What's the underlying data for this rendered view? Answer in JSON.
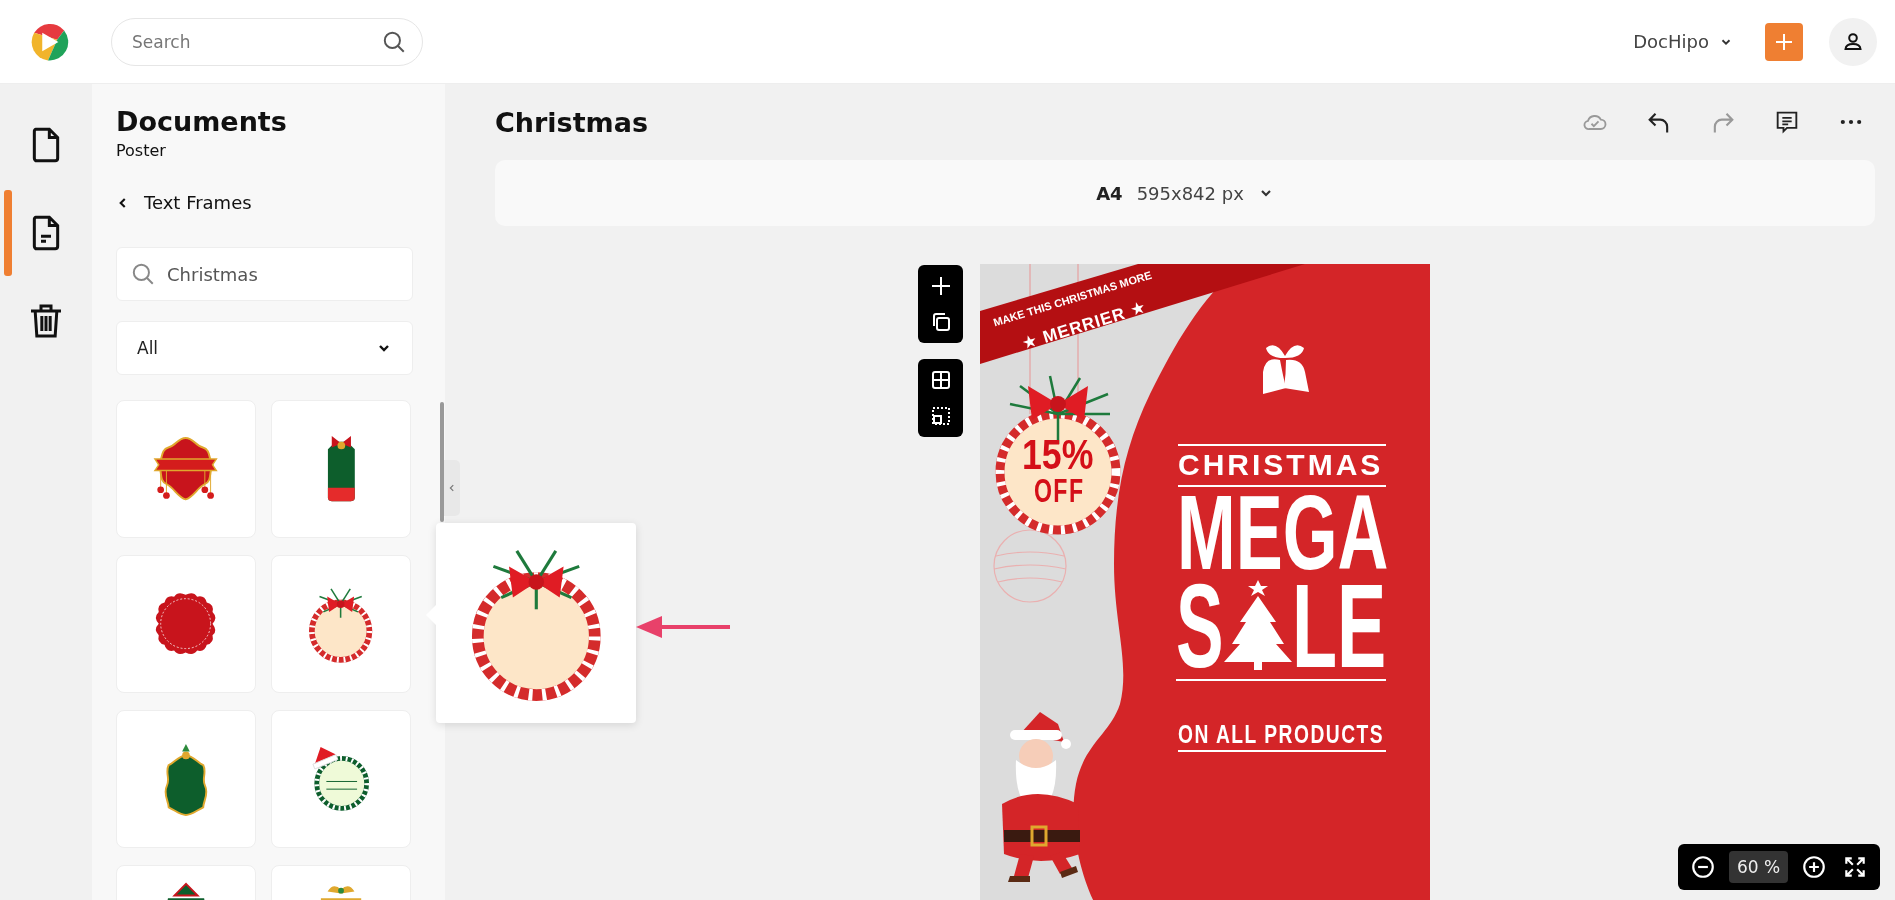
{
  "topbar": {
    "search": {
      "placeholder": "Search"
    },
    "account": {
      "label": "DocHipo"
    }
  },
  "rail": [
    {
      "kind": "document",
      "selected": false
    },
    {
      "kind": "template",
      "selected": true
    },
    {
      "kind": "trash",
      "selected": false
    }
  ],
  "panel": {
    "title": "Documents",
    "subtitle": "Poster",
    "back_label": "Text Frames",
    "search": {
      "value": "Christmas"
    },
    "filter": {
      "value": "All"
    },
    "thumbnails": [
      {
        "kind": "banner"
      },
      {
        "kind": "tag"
      },
      {
        "kind": "badge"
      },
      {
        "kind": "wreath"
      },
      {
        "kind": "frame"
      },
      {
        "kind": "hatframe"
      },
      {
        "kind": "tree"
      },
      {
        "kind": "bells"
      }
    ],
    "preview": {
      "kind": "wreath"
    }
  },
  "editor": {
    "title": "Christmas",
    "actions": [
      {
        "kind": "cloud",
        "disabled": true
      },
      {
        "kind": "undo",
        "disabled": false
      },
      {
        "kind": "redo",
        "disabled": true
      },
      {
        "kind": "comments",
        "disabled": false
      },
      {
        "kind": "more",
        "disabled": false
      }
    ],
    "page_size": "**A4** 595x842 px",
    "zoom": {
      "value": "60 %"
    }
  },
  "poster": {
    "ribbon_top": "MAKE THIS CHRISTMAS MORE",
    "ribbon_main": "★ MERRIER ★",
    "discount": "15%",
    "discount_sub": "OFF",
    "heading": "CHRISTMAS",
    "headline": "MEGA",
    "sale_start": "S",
    "sale_end": "LE",
    "footer": "ON ALL PRODUCTS"
  }
}
